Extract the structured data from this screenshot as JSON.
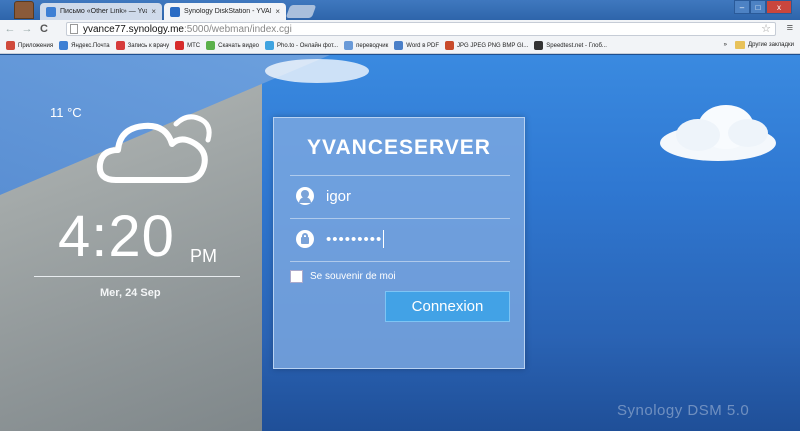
{
  "browser": {
    "tabs": [
      {
        "label": "Письмо «Other Link» — Yva",
        "close": "×"
      },
      {
        "label": "Synology DiskStation - YVAN",
        "close": "×"
      }
    ],
    "window_controls": {
      "minimize": "–",
      "maximize": "□",
      "close": "x"
    },
    "address": {
      "host": "yvance77.synology.me",
      "rest": ":5000/webman/index.cgi"
    },
    "nav": {
      "back": "←",
      "forward": "→",
      "reload": "C"
    },
    "star": "☆",
    "menu": "≡",
    "bookmarks": [
      {
        "label": "Приложения",
        "color": "#d04a3c"
      },
      {
        "label": "Яндекс.Почта",
        "color": "#3d7fd4"
      },
      {
        "label": "Запись к врачу",
        "color": "#d63b3b"
      },
      {
        "label": "МТС",
        "color": "#d62b2b"
      },
      {
        "label": "Скачать видео",
        "color": "#5ab04a"
      },
      {
        "label": "Pho.to - Онлайн фот...",
        "color": "#3fa3e0"
      },
      {
        "label": "переводчик",
        "color": "#6a9ad8"
      },
      {
        "label": "Word в PDF",
        "color": "#4a7fc8"
      },
      {
        "label": "JPG JPEG PNG BMP GI...",
        "color": "#c84a2a"
      },
      {
        "label": "Speedtest.net - Глоб...",
        "color": "#333333"
      }
    ],
    "bookmarks_more": "»",
    "other_bookmarks": "Другие закладки"
  },
  "widget": {
    "temperature": "11 °C",
    "time": "4:20",
    "ampm": "PM",
    "date": "Mer, 24 Sep"
  },
  "login": {
    "server_name": "YVANCESERVER",
    "username": "igor",
    "password": "•••••••••",
    "remember_label": "Se souvenir de moi",
    "login_button": "Connexion"
  },
  "branding": "Synology DSM 5.0",
  "colors": {
    "accent_button": "#42a2e6",
    "sky": "#2f78d2"
  }
}
